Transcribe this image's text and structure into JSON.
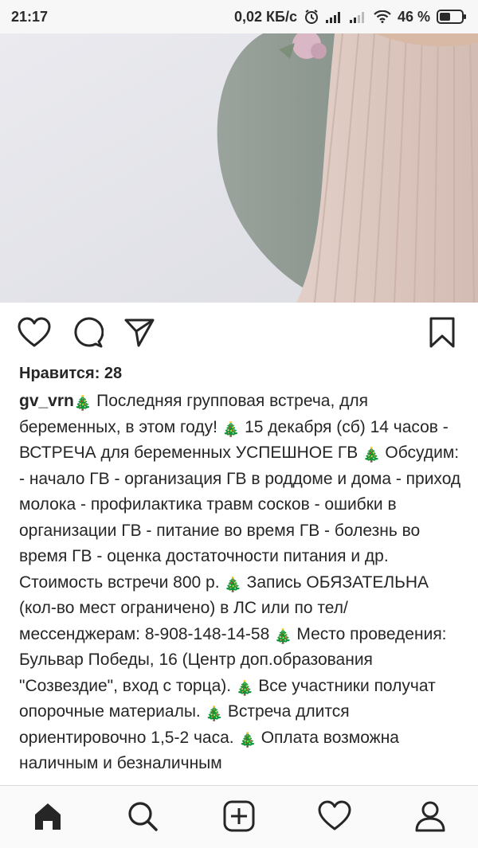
{
  "status_bar": {
    "time": "21:17",
    "network_speed": "0,02 КБ/с",
    "battery_percent": "46 %",
    "icons": [
      "alarm-icon",
      "signal-icon",
      "signal-weak-icon",
      "wifi-icon",
      "battery-icon"
    ]
  },
  "post": {
    "photo_alt": "pregnant-belly-photo",
    "likes_text": "Нравится: 28",
    "username": "gv_vrn",
    "caption_segments": [
      " Последняя групповая встреча, для беременных, в этом году! ",
      " 15 декабря (сб) 14 часов - ВСТРЕЧА для беременных УСПЕШНОЕ ГВ ",
      " Обсудим: - начало ГВ - организация ГВ в роддоме и дома - приход молока - профилактика травм сосков - ошибки в организации ГВ - питание во время ГВ - болезнь во время ГВ - оценка достаточности питания и др. Стоимость встречи 800 р. ",
      " Запись ОБЯЗАТЕЛЬНА (кол-во мест ограничено) в ЛС или по тел/мессенджерам: 8-908-148-14-58 ",
      " Место проведения: Бульвар Победы, 16 (Центр доп.образования \"Созвездие\", вход с торца). ",
      " Все участники получат опорочные материалы. ",
      " Встреча длится ориентировочно 1,5-2 часа. ",
      " Оплата возможна наличным и безналичным"
    ],
    "emoji_char": "🎄"
  },
  "actions": [
    "heart-icon",
    "comment-icon",
    "share-icon",
    "bookmark-icon"
  ],
  "bottom_nav": [
    "home-icon",
    "search-icon",
    "add-post-icon",
    "activity-heart-icon",
    "profile-icon"
  ],
  "colors": {
    "text": "#262626",
    "tree_green": "#4d7a2a",
    "status_bg": "#f7f7f7",
    "nav_bg": "#fafafa"
  }
}
